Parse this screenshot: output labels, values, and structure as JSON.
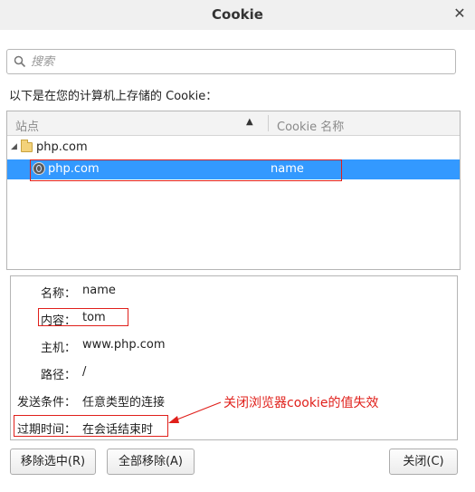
{
  "window": {
    "title": "Cookie",
    "close_glyph": "✕"
  },
  "search": {
    "placeholder": "搜索",
    "value": "",
    "icon": "search-icon"
  },
  "description": "以下是在您的计算机上存储的 Cookie：",
  "tree": {
    "columns": {
      "site": "站点",
      "cookie_name": "Cookie 名称",
      "sort_indicator": "▲"
    },
    "folder": {
      "label": "php.com",
      "expanded": true,
      "icon": "folder-icon"
    },
    "selected_row": {
      "site": "php.com",
      "cookie_name": "name",
      "icon": "globe-icon"
    }
  },
  "details": {
    "name": {
      "label": "名称：",
      "value": "name"
    },
    "content": {
      "label": "内容：",
      "value": "tom"
    },
    "host": {
      "label": "主机：",
      "value": "www.php.com"
    },
    "path": {
      "label": "路径：",
      "value": "/"
    },
    "send_for": {
      "label": "发送条件：",
      "value": "任意类型的连接"
    },
    "expires": {
      "label": "过期时间：",
      "value": "在会话结束时"
    }
  },
  "annotation": {
    "text": "关闭浏览器cookie的值失效",
    "color": "#e0201b"
  },
  "buttons": {
    "remove_selected": "移除选中(R)",
    "remove_all": "全部移除(A)",
    "close": "关闭(C)"
  },
  "colors": {
    "selection": "#3399ff",
    "annotation_red": "#e0201b"
  }
}
